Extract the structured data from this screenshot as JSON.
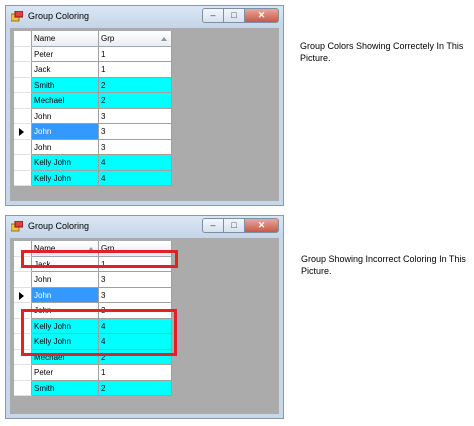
{
  "window1": {
    "title": "Group Coloring",
    "columns": [
      "Name",
      "Grp"
    ],
    "rows": [
      {
        "name": "Peter",
        "grp": "1",
        "style": "white"
      },
      {
        "name": "Jack",
        "grp": "1",
        "style": "white"
      },
      {
        "name": "Smith",
        "grp": "2",
        "style": "cyan"
      },
      {
        "name": "Mechael",
        "grp": "2",
        "style": "cyan"
      },
      {
        "name": "John",
        "grp": "3",
        "style": "white"
      },
      {
        "name": "John",
        "grp": "3",
        "style": "selected",
        "current": true
      },
      {
        "name": "John",
        "grp": "3",
        "style": "white"
      },
      {
        "name": "Kelly John",
        "grp": "4",
        "style": "cyan"
      },
      {
        "name": "Kelly John",
        "grp": "4",
        "style": "cyan"
      }
    ]
  },
  "window2": {
    "title": "Group Coloring",
    "columns": [
      "Name",
      "Grp"
    ],
    "rows": [
      {
        "name": "Jack",
        "grp": "1",
        "style": "white"
      },
      {
        "name": "John",
        "grp": "3",
        "style": "white"
      },
      {
        "name": "John",
        "grp": "3",
        "style": "selected",
        "current": true
      },
      {
        "name": "John",
        "grp": "3",
        "style": "white"
      },
      {
        "name": "Kelly John",
        "grp": "4",
        "style": "cyan"
      },
      {
        "name": "Kelly John",
        "grp": "4",
        "style": "cyan"
      },
      {
        "name": "Mechael",
        "grp": "2",
        "style": "cyan"
      },
      {
        "name": "Peter",
        "grp": "1",
        "style": "white"
      },
      {
        "name": "Smith",
        "grp": "2",
        "style": "cyan"
      }
    ]
  },
  "caption1": "Group Colors Showing Correctely In This Picture.",
  "caption2": "Group Showing Incorrect Coloring In This Picture.",
  "colors": {
    "group_highlight": "#00ffff",
    "selection": "#3399ff",
    "annotation": "#e0202a"
  },
  "icons": {
    "sort": "sort-ascending-icon",
    "row_pointer": "current-row-icon"
  }
}
